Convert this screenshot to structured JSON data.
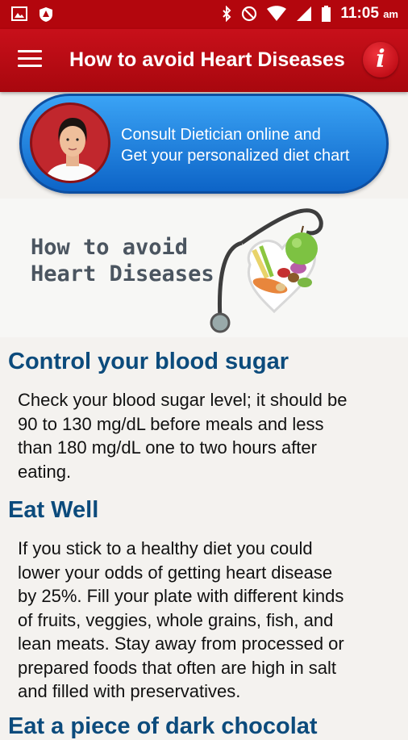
{
  "status_bar": {
    "time": "11:05",
    "ampm": "am",
    "icons": [
      "image-icon",
      "shield-icon",
      "bluetooth-icon",
      "do-not-disturb-icon",
      "wifi-icon",
      "signal-icon",
      "battery-icon"
    ]
  },
  "app_bar": {
    "title": "How to avoid Heart Diseases",
    "info_label": "i",
    "icons": [
      "menu-icon",
      "info-icon"
    ]
  },
  "consult": {
    "line1": "Consult Dietician online and",
    "line2": "Get your personalized diet chart"
  },
  "hero": {
    "line1": "How to avoid",
    "line2": "Heart Diseases"
  },
  "sections": [
    {
      "heading": "Control your blood sugar",
      "lines": [
        "Check your blood sugar level; it should be",
        "90 to 130 mg/dL before meals and less",
        "than 180 mg/dL one to two hours after",
        "eating."
      ]
    },
    {
      "heading": "Eat Well",
      "lines": [
        "If you stick to a healthy diet you could",
        "lower your odds of getting heart disease",
        "by 25%. Fill your plate with different kinds",
        "of fruits, veggies, whole grains, fish, and",
        "lean meats. Stay away from processed or",
        "prepared foods that often are high in salt",
        "and filled with preservatives."
      ]
    },
    {
      "heading": "Eat a piece of dark chocolat"
    }
  ],
  "colors": {
    "status_bar": "#b3060d",
    "app_bar": "#c8101a",
    "heading": "#0c4b7c",
    "consult_blue": "#1f82e0"
  }
}
